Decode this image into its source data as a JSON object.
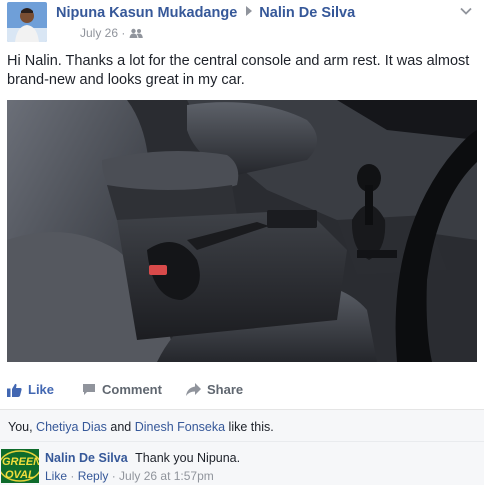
{
  "post": {
    "author": "Nipuna Kasun Mukadange",
    "recipient": "Nalin De Silva",
    "date": "July 26",
    "separator": "·",
    "text": "Hi Nalin. Thanks a lot for the central console and arm rest. It was almost brand-new and looks great in my car.",
    "photo_alt": "Car interior showing central console, arm rest, gear shift and steering wheel"
  },
  "actions": {
    "like": "Like",
    "comment": "Comment",
    "share": "Share"
  },
  "likes": {
    "prefix": "You, ",
    "person1": "Chetiya Dias",
    "and": " and ",
    "person2": "Dinesh Fonseka",
    "suffix": " like this."
  },
  "comment": {
    "author": "Nalin De Silva",
    "text": "Thank you Nipuna.",
    "like": "Like",
    "dot1": " · ",
    "reply": "Reply",
    "dot2": " · ",
    "timestamp": "July 26 at 1:57pm",
    "avatar_text_line1": "GREEN",
    "avatar_text_line2": "OVAL"
  },
  "colors": {
    "link": "#365899",
    "like_active": "#4267b2",
    "muted": "#90949c",
    "comment_bg": "#f6f7f9"
  },
  "icons": [
    "people-icon",
    "chevron-down-icon",
    "like-icon",
    "comment-icon",
    "share-icon"
  ]
}
